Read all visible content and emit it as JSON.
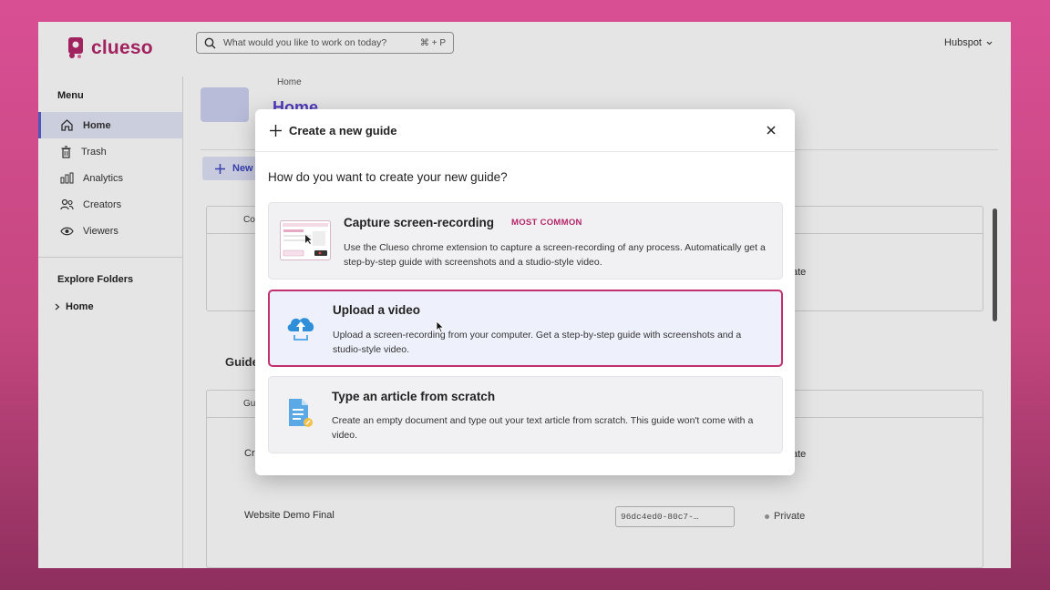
{
  "app": {
    "logo_text": "clueso",
    "search_placeholder": "What would you like to work on today?",
    "search_shortcut": "⌘ + P",
    "workspace": "Hubspot"
  },
  "sidebar": {
    "menu_heading": "Menu",
    "items": [
      {
        "label": "Home",
        "icon": "home-icon",
        "active": true
      },
      {
        "label": "Trash",
        "icon": "trash-icon",
        "active": false
      },
      {
        "label": "Analytics",
        "icon": "analytics-icon",
        "active": false
      },
      {
        "label": "Creators",
        "icon": "creators-icon",
        "active": false
      },
      {
        "label": "Viewers",
        "icon": "eye-icon",
        "active": false
      }
    ],
    "folders_heading": "Explore Folders",
    "folders": [
      {
        "label": "Home"
      }
    ]
  },
  "main": {
    "breadcrumb": "Home",
    "title": "Home",
    "new_button": "New",
    "panel1_col": "Co",
    "guides_heading": "Guide",
    "panel2_col": "Gu",
    "row_partial": "Cr",
    "privacy_partial_1": "ate",
    "privacy_partial_2": "ate",
    "row_title": "Website Demo Final",
    "row_hash": "96dc4ed0-80c7-…",
    "row_privacy": "Private"
  },
  "modal": {
    "title": "Create a new guide",
    "question": "How do you want to create your new guide?",
    "options": [
      {
        "title": "Capture screen-recording",
        "badge": "MOST COMMON",
        "desc": "Use the Clueso chrome extension to capture a screen-recording of any process. Automatically get a step-by-step guide with screenshots and a studio-style video."
      },
      {
        "title": "Upload a video",
        "desc": "Upload a screen-recording from your computer. Get a step-by-step guide with screenshots and a studio-style video."
      },
      {
        "title": "Type an article from scratch",
        "desc": "Create an empty document and type out your text article from scratch. This guide won't come with a video."
      }
    ]
  },
  "colors": {
    "brand": "#b3266a",
    "accent": "#5a5fd0",
    "selected_border": "#c2306f"
  }
}
